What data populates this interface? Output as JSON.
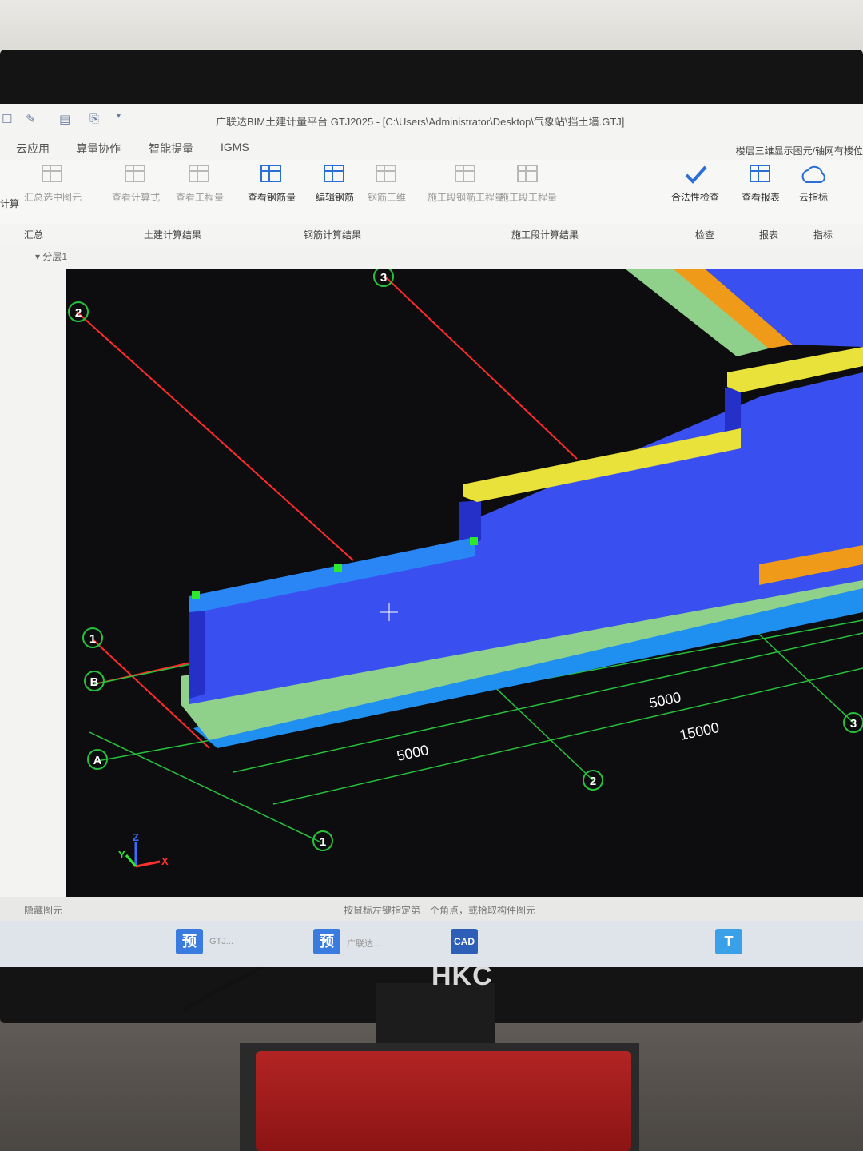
{
  "window": {
    "title": "广联达BIM土建计量平台 GTJ2025 - [C:\\Users\\Administrator\\Desktop\\气象站\\挡土墙.GTJ]"
  },
  "menu": {
    "items": [
      "云应用",
      "算量协作",
      "智能提量",
      "IGMS"
    ],
    "right_text": "楼层三维显示图元/轴网有楼位"
  },
  "ribbon": {
    "tools": [
      {
        "label": "汇总选中图元",
        "icon": "sum-icon"
      },
      {
        "label": "查看计算式",
        "icon": "calc-formula-icon"
      },
      {
        "label": "查看工程量",
        "icon": "quantity-icon"
      },
      {
        "label": "查看钢筋量",
        "icon": "rebar-quantity-icon"
      },
      {
        "label": "编辑钢筋",
        "icon": "edit-rebar-icon"
      },
      {
        "label": "钢筋三维",
        "icon": "rebar-3d-icon"
      },
      {
        "label": "施工段钢筋工程量",
        "icon": "stage-rebar-icon"
      },
      {
        "label": "施工段工程量",
        "icon": "stage-quantity-icon"
      },
      {
        "label": "合法性检查",
        "icon": "check-icon"
      },
      {
        "label": "查看报表",
        "icon": "report-icon"
      },
      {
        "label": "云指标",
        "icon": "cloud-index-icon"
      }
    ],
    "partial_label": "计算",
    "groups": [
      "汇总",
      "土建计算结果",
      "钢筋计算结果",
      "施工段计算结果",
      "检查",
      "报表",
      "指标"
    ]
  },
  "left_panel": {
    "floor": "分层1"
  },
  "viewport": {
    "axis_labels": {
      "axis_1": "1",
      "axis_2": "2",
      "axis_3": "3",
      "axis_A": "A",
      "axis_B": "B"
    },
    "dimensions": {
      "d1": "5000",
      "d2": "5000",
      "d3": "15000"
    },
    "gizmo": {
      "x": "X",
      "y": "Y",
      "z": "Z"
    },
    "colors": {
      "wall": "#3a4ff0",
      "cap": "#e8e23a",
      "footing_green": "#8fd18b",
      "footing_blue": "#1f8ff0",
      "orange": "#f09a1a",
      "axis_red": "#ff2a2a",
      "axis_green": "#27c23b"
    }
  },
  "status": {
    "left": "隐藏图元",
    "hint": "按鼠标左键指定第一个角点，或拾取构件图元"
  },
  "taskbar": {
    "items": [
      {
        "label": "预",
        "text": "GTJ..."
      },
      {
        "label": "预",
        "text": "广联达..."
      },
      {
        "label": "CAD",
        "text": ""
      }
    ]
  },
  "monitor": {
    "brand": "HKC"
  }
}
